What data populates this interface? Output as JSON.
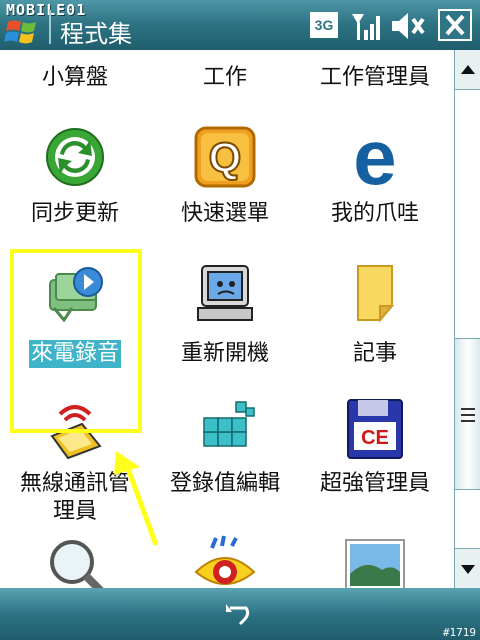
{
  "header": {
    "watermark": "MOBILE01",
    "title": "程式集",
    "network_label": "3G"
  },
  "programs": {
    "row0": [
      "小算盤",
      "工作",
      "工作管理員"
    ],
    "row1": [
      "同步更新",
      "快速選單",
      "我的爪哇"
    ],
    "row2": [
      "來電錄音",
      "重新開機",
      "記事"
    ],
    "row3": [
      "無線通訊管理員",
      "登錄值編輯",
      "超強管理員"
    ],
    "row3_wrapped": [
      "無線通訊管",
      "理員"
    ],
    "quick_menu_letter": "Q",
    "java_letter": "e",
    "ce_label": "CE"
  },
  "selected_item": "來電錄音",
  "colors": {
    "bar": "#2f7585",
    "highlight_box": "#ffff1c",
    "selection": "#3fb4c8"
  },
  "footer": {
    "counter": "#1719"
  }
}
